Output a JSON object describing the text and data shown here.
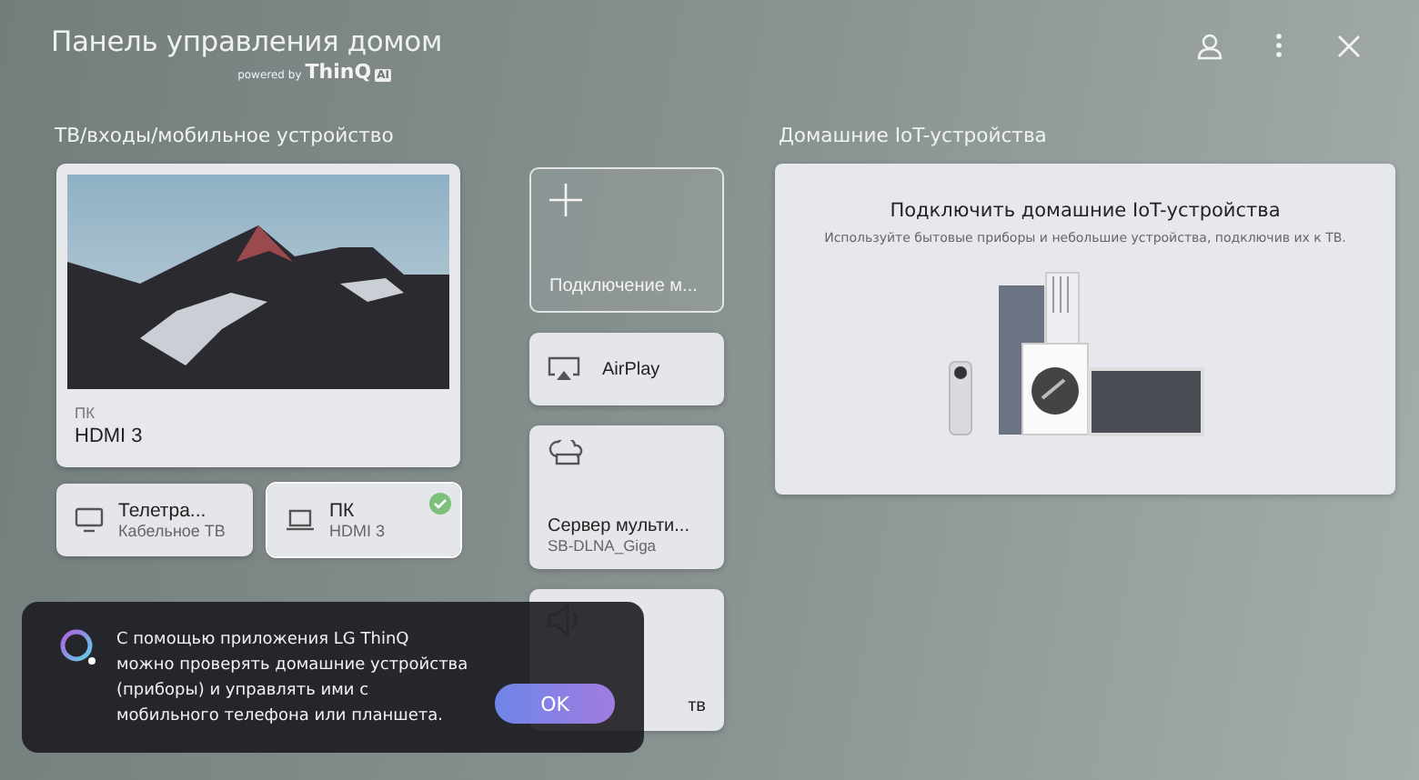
{
  "header": {
    "title": "Панель управления домом",
    "powered_by": "powered by",
    "brand": "ThinQ",
    "brand_badge": "AI"
  },
  "sources": {
    "heading": "ТВ/входы/мобильное устройство",
    "current": {
      "label": "ПК",
      "name": "HDMI 3"
    },
    "inputs": [
      {
        "kind": "tv",
        "name": "Телетра...",
        "sub": "Кабельное ТВ",
        "selected": false
      },
      {
        "kind": "laptop",
        "name": "ПК",
        "sub": "HDMI 3",
        "selected": true
      }
    ],
    "actions": [
      {
        "kind": "add",
        "name": "Подключение м..."
      },
      {
        "kind": "airplay",
        "name": "AirPlay"
      },
      {
        "kind": "server",
        "name": "Сервер мульти...",
        "sub": "SB-DLNA_Giga"
      },
      {
        "kind": "speaker",
        "name": "тв"
      }
    ]
  },
  "iot": {
    "heading": "Домашние IoT-устройства",
    "title": "Подключить домашние IoT-устройства",
    "subtitle": "Используйте бытовые приборы и небольшие устройства, подключив их к ТВ."
  },
  "toast": {
    "lines": [
      "С помощью приложения LG ThinQ",
      "можно проверять домашние устройства",
      "(приборы) и управлять ими с",
      "мобильного телефона или планшета."
    ],
    "button": "OK"
  }
}
